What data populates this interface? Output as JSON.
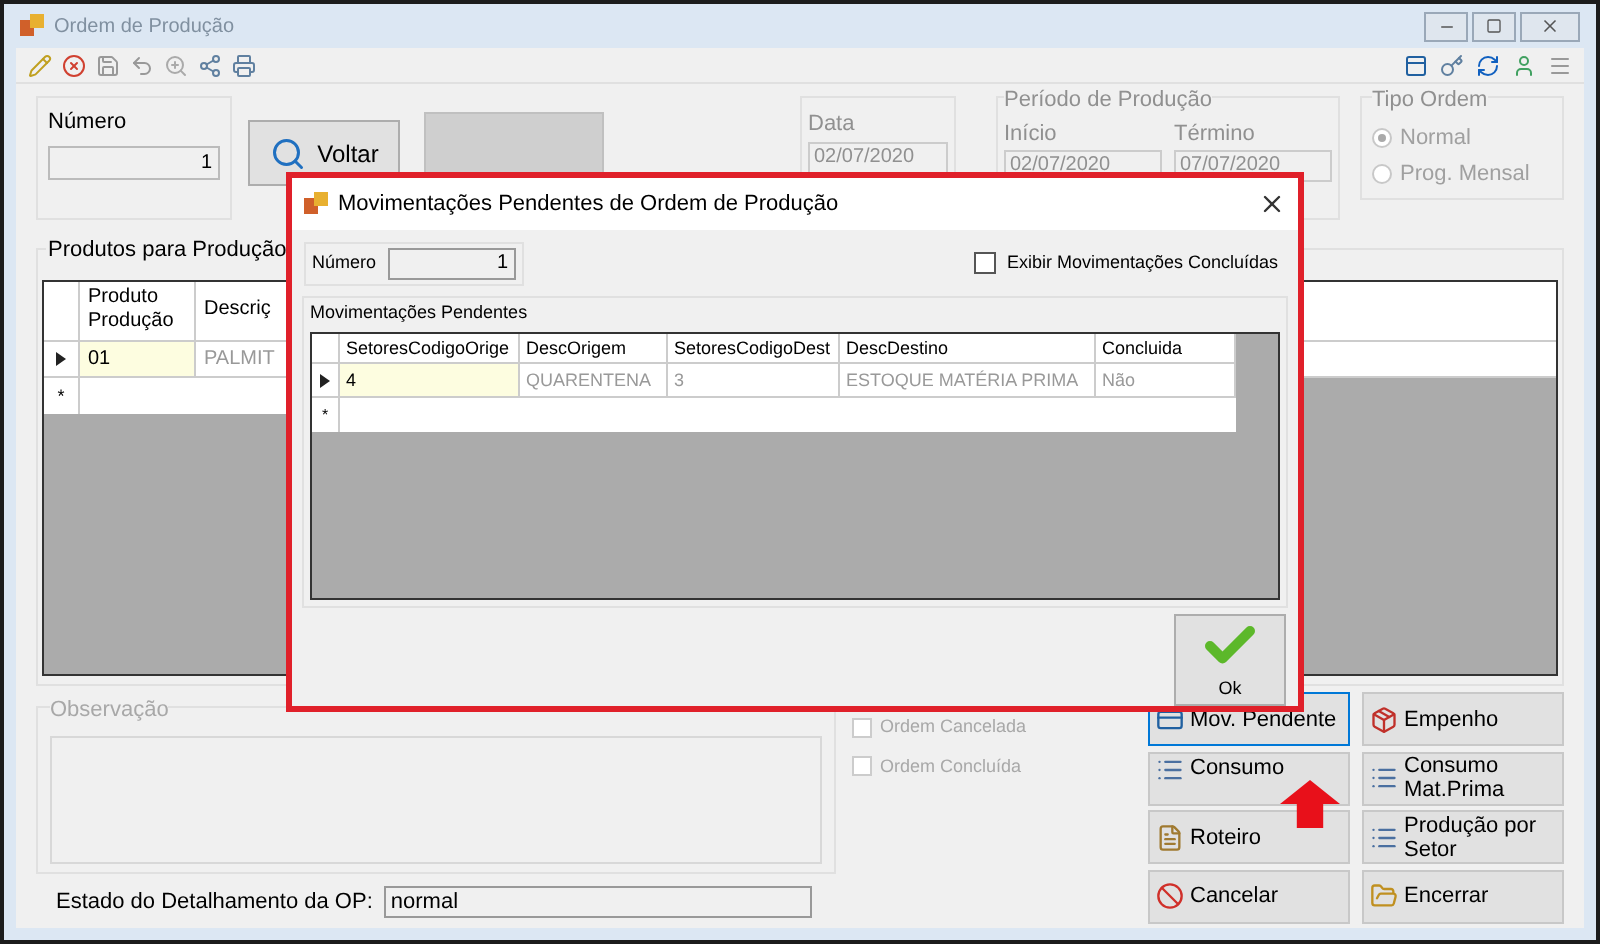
{
  "window": {
    "title": "Ordem de Produção"
  },
  "numero": {
    "label": "Número",
    "value": "1"
  },
  "voltar_button": {
    "label": "Voltar"
  },
  "data": {
    "label": "Data",
    "value": "02/07/2020",
    "disabled": true
  },
  "periodo": {
    "title": "Período de Produção",
    "inicio": {
      "label": "Início",
      "value": "02/07/2020"
    },
    "termino": {
      "label": "Término",
      "value": "07/07/2020"
    }
  },
  "tipo_ordem": {
    "title": "Tipo Ordem",
    "options": [
      {
        "label": "Normal",
        "selected": true
      },
      {
        "label": "Prog. Mensal",
        "selected": false
      }
    ]
  },
  "produtos": {
    "title": "Produtos para Produção",
    "columns": [
      "Produto Produção",
      "Descriç"
    ],
    "rows": [
      {
        "current": true,
        "cells": [
          "01",
          "PALMIT"
        ]
      }
    ],
    "new_row_marker": "*"
  },
  "observacao": {
    "title": "Observação"
  },
  "options": [
    {
      "label": "Ordem Cancelada",
      "checked": false
    },
    {
      "label": "Ordem Concluída",
      "checked": false
    }
  ],
  "actions": [
    {
      "label": "Mov. Pendente",
      "kind": "card",
      "focused": true
    },
    {
      "label": "Empenho",
      "kind": "box",
      "focused": false
    },
    {
      "label": "Consumo",
      "kind": "list",
      "focused": false
    },
    {
      "label": "Consumo Mat.Prima",
      "kind": "list",
      "focused": false
    },
    {
      "label": "Roteiro",
      "kind": "doc",
      "focused": false
    },
    {
      "label": "Produção por Setor",
      "kind": "list",
      "focused": false
    },
    {
      "label": "Cancelar",
      "kind": "stop",
      "focused": false
    },
    {
      "label": "Encerrar",
      "kind": "folder",
      "focused": false
    }
  ],
  "estado": {
    "label": "Estado do Detalhamento da OP:",
    "value": "normal"
  },
  "dialog": {
    "title": "Movimentações Pendentes de Ordem de Produção",
    "numero": {
      "label": "Número",
      "value": "1"
    },
    "show_completed": {
      "label": "Exibir Movimentações Concluídas",
      "checked": false
    },
    "group_title": "Movimentações Pendentes",
    "columns": [
      "SetoresCodigoOrige",
      "DescOrigem",
      "SetoresCodigoDest",
      "DescDestino",
      "Concluida"
    ],
    "rows": [
      {
        "current": true,
        "cells": [
          "4",
          "QUARENTENA",
          "3",
          "ESTOQUE MATÉRIA PRIMA",
          "Não"
        ]
      }
    ],
    "new_row_marker": "*",
    "ok_button": {
      "label": "Ok"
    }
  }
}
